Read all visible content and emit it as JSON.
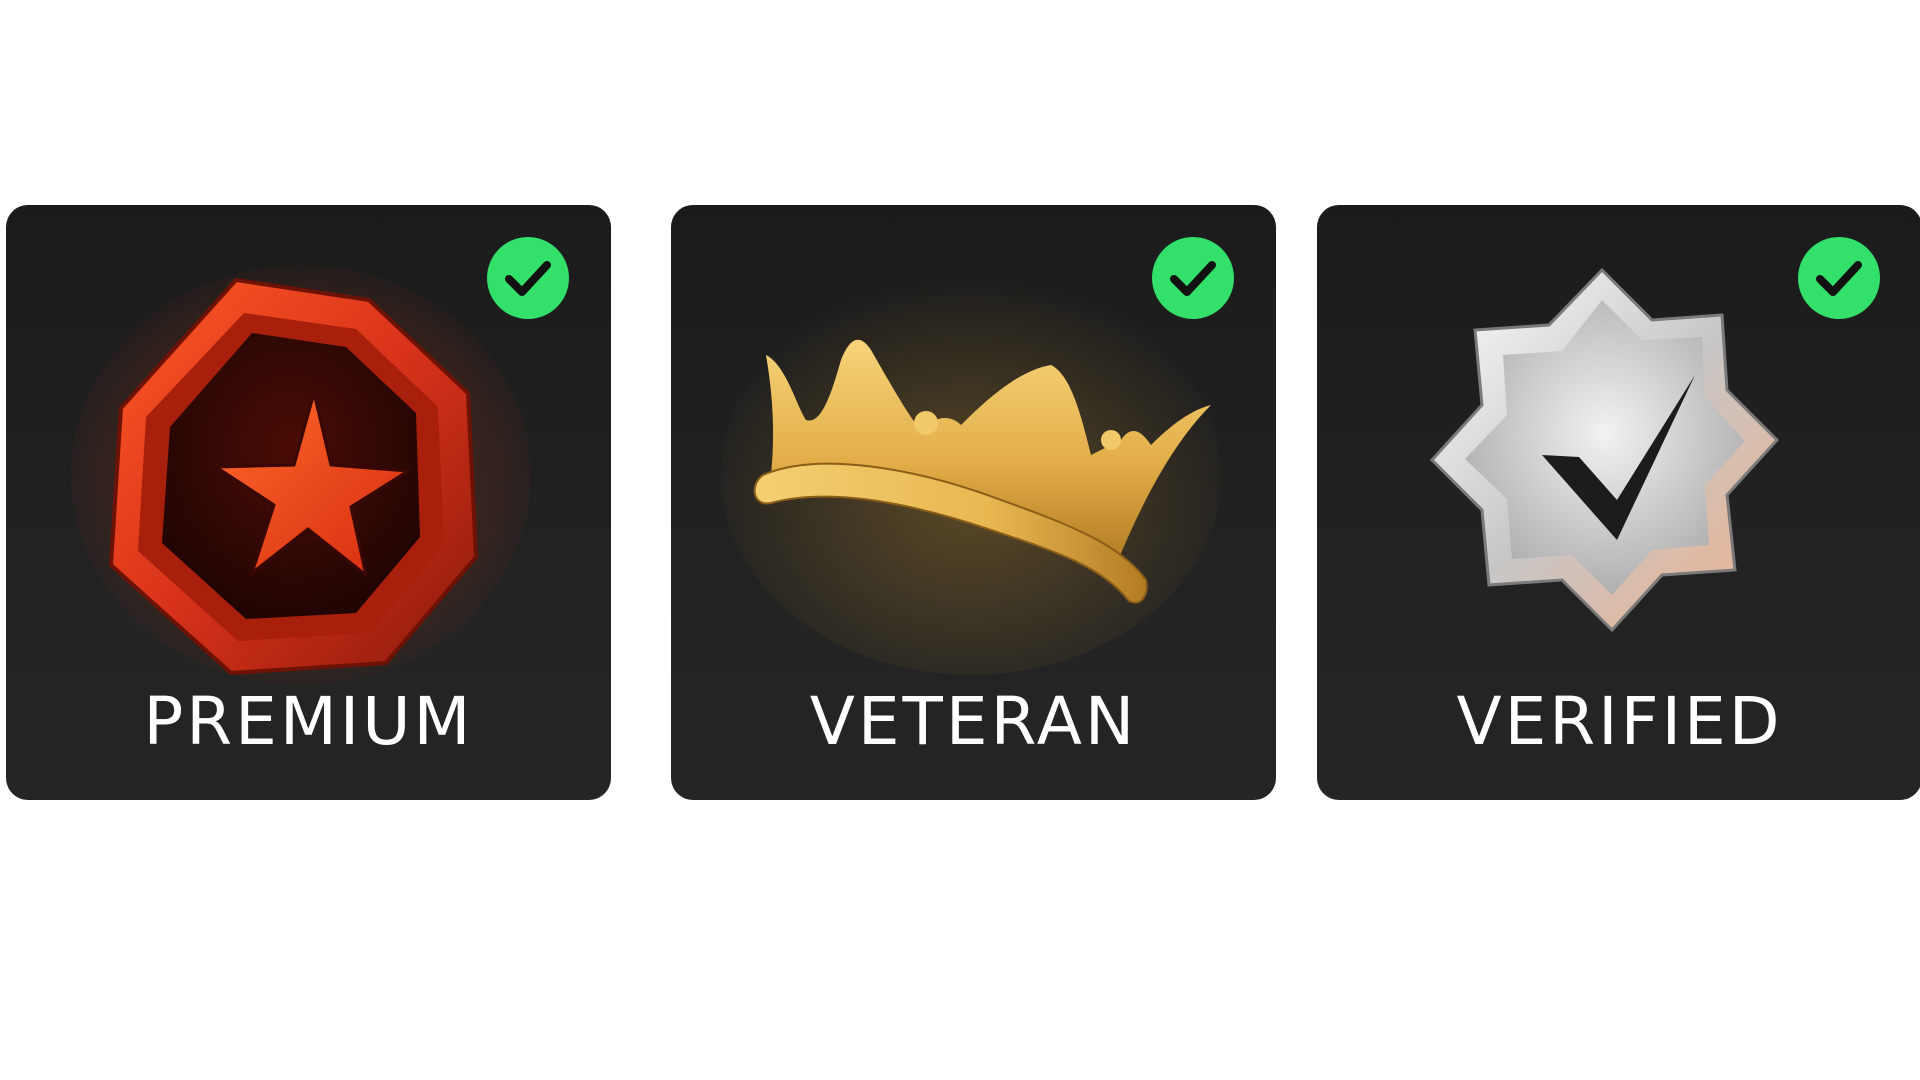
{
  "badges": [
    {
      "label": "PREMIUM",
      "icon": "red-octagon-star-icon",
      "unlocked": true,
      "accent": "#e8461c"
    },
    {
      "label": "VETERAN",
      "icon": "gold-crown-icon",
      "unlocked": true,
      "accent": "#e9b84a"
    },
    {
      "label": "VERIFIED",
      "icon": "silver-star-checkmark-icon",
      "unlocked": true,
      "accent": "#d9d9d9"
    }
  ],
  "colors": {
    "card_bg": "#1f1f1f",
    "check_green": "#33e06a",
    "page_bg": "#ffffff"
  }
}
